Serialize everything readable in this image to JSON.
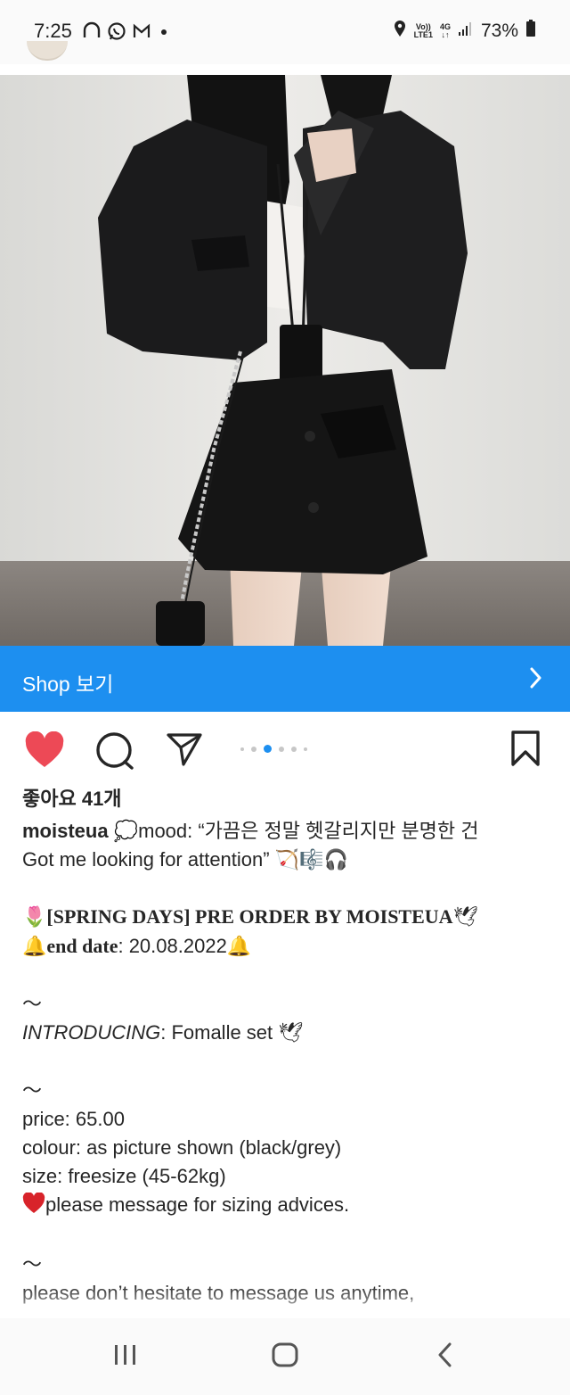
{
  "status_bar": {
    "time": "7:25",
    "network_top": "Vo))",
    "network_bottom": "LTE1",
    "data_top": "4G",
    "data_bottom": "↓↑",
    "battery": "73%",
    "notification_icons": [
      "headphones-icon",
      "whatsapp-icon",
      "gmail-icon",
      "dot-icon"
    ]
  },
  "shop": {
    "label": "Shop 보기"
  },
  "post": {
    "likes": "좋아요 41개",
    "username": "moisteua",
    "caption_line1": "💭mood: “가끔은 정말 헷갈리지만 분명한 건",
    "caption_line2": "Got me looking for attention” 🏹🎼🎧",
    "spring_line": "[SPRING DAYS] PRE ORDER BY MOISTEUA",
    "end_label": "end date",
    "end_value": ": 20.08.2022",
    "tilde": "～",
    "introducing_label": "INTRODUCING",
    "introducing_value": ": Fomalle set",
    "price": "price: 65.00",
    "colour": "colour: as picture shown (black/grey)",
    "size": "size: freesize (45-62kg)",
    "sizing_note": "please message for sizing advices.",
    "contact": "please don’t hesitate to message us anytime,"
  },
  "carousel": {
    "total": 6,
    "active_index": 2
  },
  "colors": {
    "shop_bar": "#1d8ff0",
    "like_heart": "#ed4956",
    "text": "#262626"
  }
}
